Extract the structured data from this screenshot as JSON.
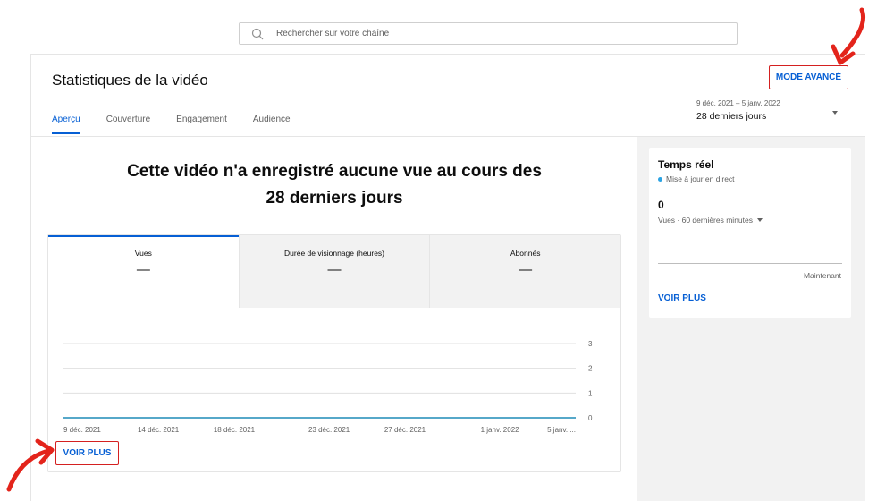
{
  "search": {
    "placeholder": "Rechercher sur votre chaîne"
  },
  "header": {
    "title": "Statistiques de la vidéo",
    "advanced_mode_label": "MODE AVANCÉ",
    "tabs": [
      {
        "label": "Aperçu",
        "active": true
      },
      {
        "label": "Couverture",
        "active": false
      },
      {
        "label": "Engagement",
        "active": false
      },
      {
        "label": "Audience",
        "active": false
      }
    ],
    "date_range": "9 déc. 2021 – 5 janv. 2022",
    "period": "28 derniers jours"
  },
  "main": {
    "headline_line1": "Cette vidéo n'a enregistré aucune vue au cours des",
    "headline_line2": "28 derniers jours",
    "metrics": [
      {
        "label": "Vues",
        "value": "—"
      },
      {
        "label": "Durée de visionnage (heures)",
        "value": "—"
      },
      {
        "label": "Abonnés",
        "value": "—"
      }
    ],
    "see_more_label": "VOIR PLUS"
  },
  "realtime": {
    "title": "Temps réel",
    "live_label": "Mise à jour en direct",
    "count": "0",
    "metric_label": "Vues · 60 dernières minutes",
    "now_label": "Maintenant",
    "see_more_label": "VOIR PLUS"
  },
  "chart_data": {
    "type": "line",
    "x_tick_labels": [
      "9 déc. 2021",
      "14 déc. 2021",
      "18 déc. 2021",
      "23 déc. 2021",
      "27 déc. 2021",
      "1 janv. 2022",
      "5 janv. ..."
    ],
    "y_tick_labels": [
      "0",
      "1",
      "2",
      "3"
    ],
    "ylim": [
      0,
      3
    ],
    "series": [
      {
        "values": [
          0,
          0,
          0,
          0,
          0,
          0,
          0,
          0,
          0,
          0,
          0,
          0,
          0,
          0,
          0,
          0,
          0,
          0,
          0,
          0,
          0,
          0,
          0,
          0,
          0,
          0,
          0,
          0
        ]
      }
    ],
    "line_color": "#56a8c9",
    "grid": true
  },
  "colors": {
    "accent_blue": "#065fd4",
    "annotation_red": "#e3241b",
    "live_dot": "#2ba3e3"
  }
}
